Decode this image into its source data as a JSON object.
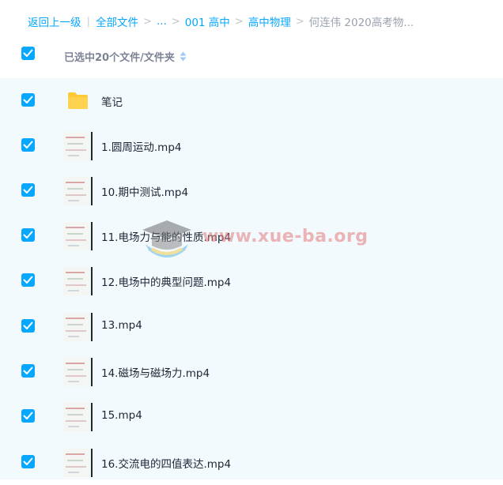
{
  "breadcrumb": {
    "back": "返回上一级",
    "all_files": "全部文件",
    "ellipsis": "...",
    "level1": "001 高中",
    "level2": "高中物理",
    "current": "何连伟 2020高考物..."
  },
  "header": {
    "selected_label": "已选中20个文件/文件夹"
  },
  "files": [
    {
      "name": "笔记",
      "type": "folder"
    },
    {
      "name": "1.圆周运动.mp4",
      "type": "video"
    },
    {
      "name": "10.期中测试.mp4",
      "type": "video"
    },
    {
      "name": "11.电场力与能的性质.mp4",
      "type": "video"
    },
    {
      "name": "12.电场中的典型问题.mp4",
      "type": "video"
    },
    {
      "name": "13.mp4",
      "type": "video"
    },
    {
      "name": "14.磁场与磁场力.mp4",
      "type": "video"
    },
    {
      "name": "15.mp4",
      "type": "video"
    },
    {
      "name": "16.交流电的四值表达.mp4",
      "type": "video"
    }
  ],
  "watermark": {
    "text": "www.xue-ba.org"
  },
  "colors": {
    "accent": "#06a7ff",
    "list_background": "#f3fafe",
    "folder": "#ffc937"
  },
  "icons": {
    "checkbox": "checkbox-checked-icon",
    "sort": "sort-icon",
    "folder": "folder-icon",
    "video": "video-thumbnail"
  }
}
